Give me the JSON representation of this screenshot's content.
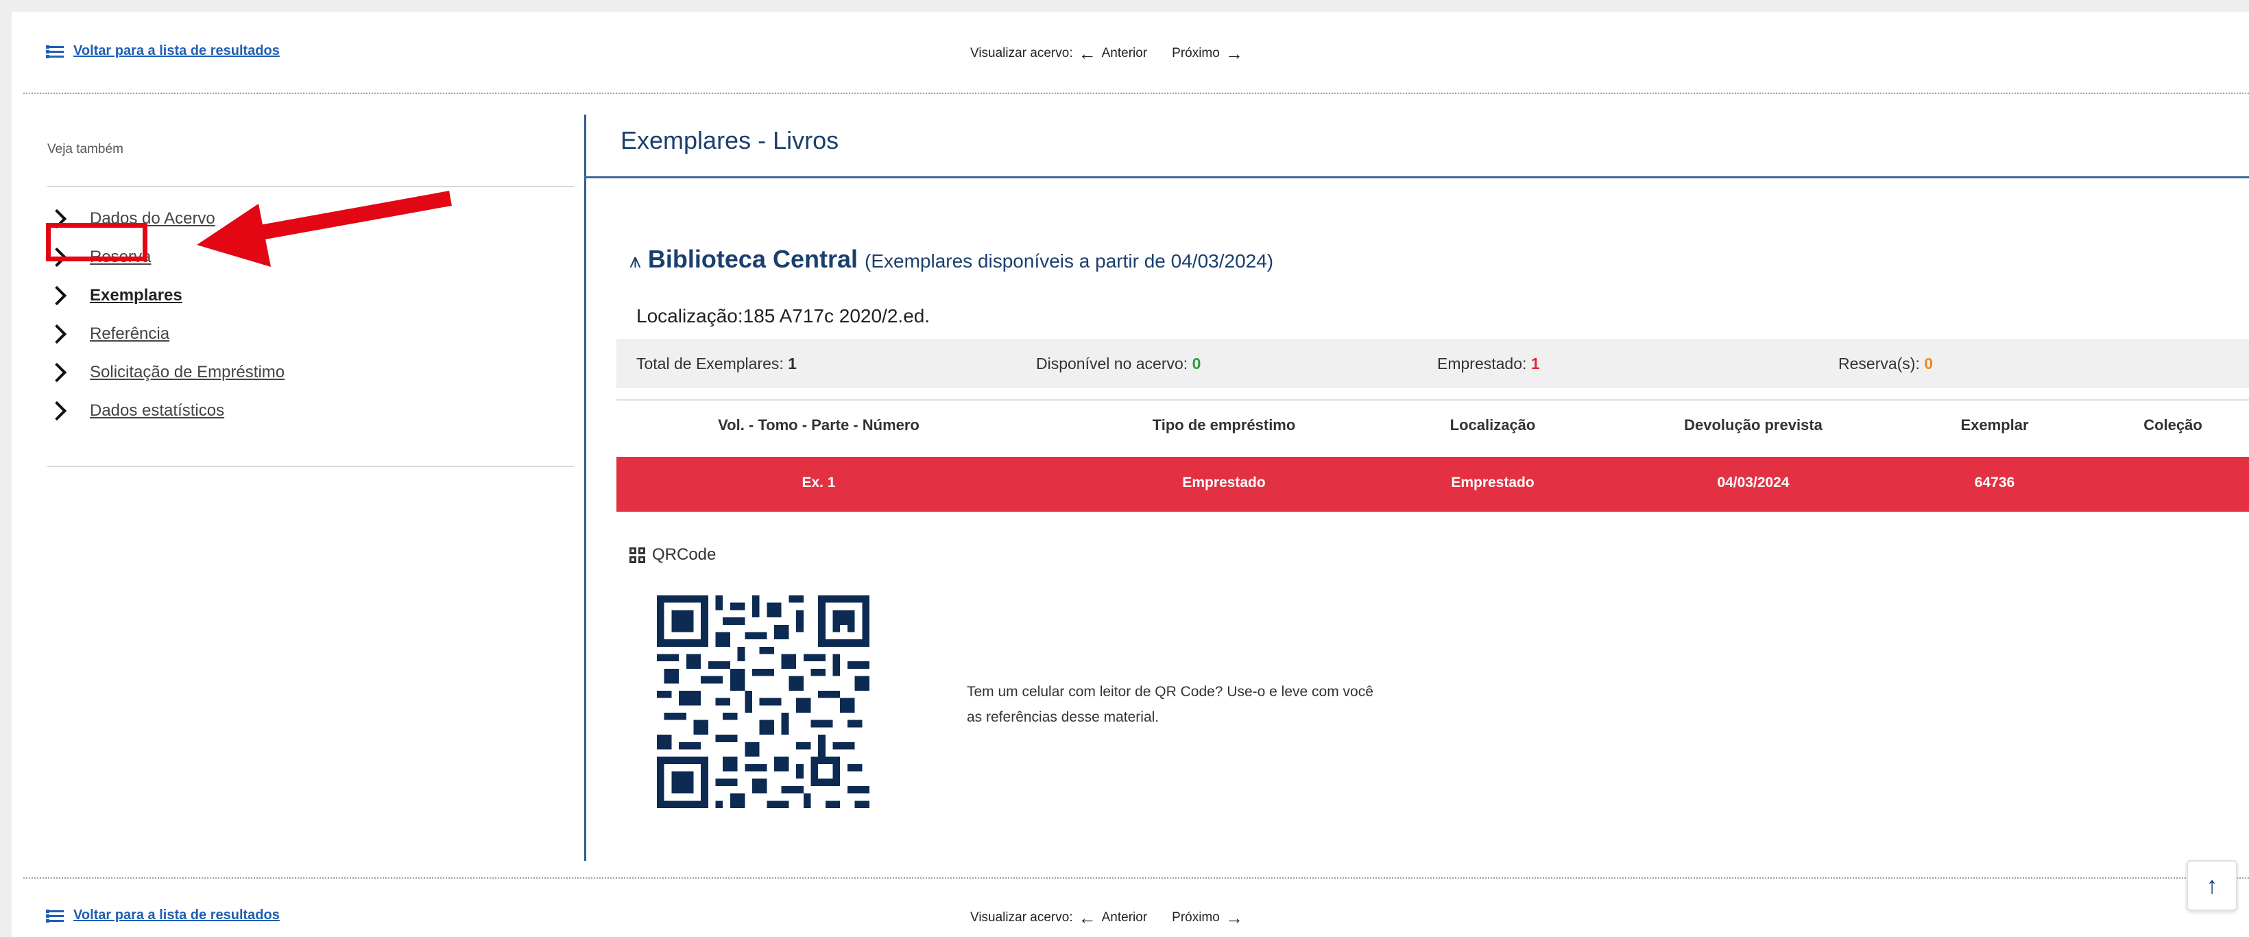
{
  "header": {
    "back_link": "Voltar para a lista de resultados",
    "visualizar_label": "Visualizar acervo:",
    "prev_label": "Anterior",
    "next_label": "Próximo"
  },
  "sidebar": {
    "see_also": "Veja também",
    "items": [
      {
        "label": "Dados do Acervo"
      },
      {
        "label": "Reserva"
      },
      {
        "label": "Exemplares"
      },
      {
        "label": "Referência"
      },
      {
        "label": "Solicitação de Empréstimo"
      },
      {
        "label": "Dados estatísticos"
      }
    ],
    "highlight_color": "#e30613"
  },
  "main": {
    "title": "Exemplares - Livros",
    "library": {
      "name": "Biblioteca Central",
      "note": "(Exemplares disponíveis a partir de 04/03/2024)",
      "localizacao": "Localização:185 A717c 2020/2.ed."
    },
    "summary": {
      "total_label": "Total de Exemplares:",
      "total_value": "1",
      "disp_label": "Disponível no acervo:",
      "disp_value": "0",
      "emp_label": "Emprestado:",
      "emp_value": "1",
      "res_label": "Reserva(s):",
      "res_value": "0"
    },
    "table": {
      "headers": [
        "Vol. - Tomo - Parte - Número",
        "Tipo de empréstimo",
        "Localização",
        "Devolução prevista",
        "Exemplar",
        "Coleção"
      ],
      "rows": [
        [
          "Ex. 1",
          "Emprestado",
          "Emprestado",
          "04/03/2024",
          "64736",
          ""
        ]
      ],
      "row_color": "#e33143"
    },
    "qr": {
      "label": "QRCode",
      "text": "Tem um celular com leitor de QR Code? Use-o e leve com você as referências desse material."
    }
  },
  "footer": {
    "back_link": "Voltar para a lista de resultados",
    "visualizar_label": "Visualizar acervo:",
    "prev_label": "Anterior",
    "next_label": "Próximo"
  },
  "icons": {
    "list": "list-icon",
    "chevron": "chevron-right-icon",
    "library": "library-icon",
    "qr": "qrcode-icon",
    "scroll_top": "arrow-up-icon"
  }
}
